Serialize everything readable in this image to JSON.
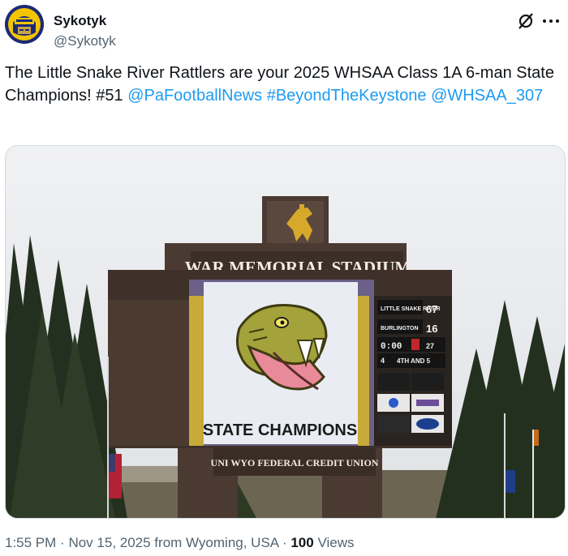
{
  "author": {
    "display_name": "Sykotyk",
    "handle": "@Sykotyk",
    "avatar_icon": "helmet-avatar-icon"
  },
  "actions": {
    "grok_icon": "grok-slash-icon",
    "more_icon": "more-dots-icon"
  },
  "tweet": {
    "text_part1": "The Little Snake River Rattlers are your 2025 WHSAA Class 1A 6-man State Champions! #51 ",
    "mention1": "@PaFootballNews",
    "hashtag": "#BeyondTheKeystone",
    "mention2": "@WHSAA_307"
  },
  "media": {
    "stadium_name": "WAR MEMORIAL STADIUM",
    "screen_caption": "STATE CHAMPIONS",
    "sponsor": "UNI WYO FEDERAL CREDIT UNION",
    "scoreboard": {
      "home_team": "LITTLE SNAKE RIVER",
      "home_score": "67",
      "away_team": "BURLINGTON",
      "away_score": "16",
      "clock": "0:00",
      "quarter": "4",
      "down": "4TH AND 5",
      "yard": "27"
    }
  },
  "footer": {
    "time": "1:55 PM",
    "separator": "·",
    "date": "Nov 15, 2025 from Wyoming, USA",
    "views_count": "100",
    "views_label": "Views"
  },
  "colors": {
    "link": "#1d9bf0",
    "text": "#0f1419",
    "muted": "#536471"
  }
}
